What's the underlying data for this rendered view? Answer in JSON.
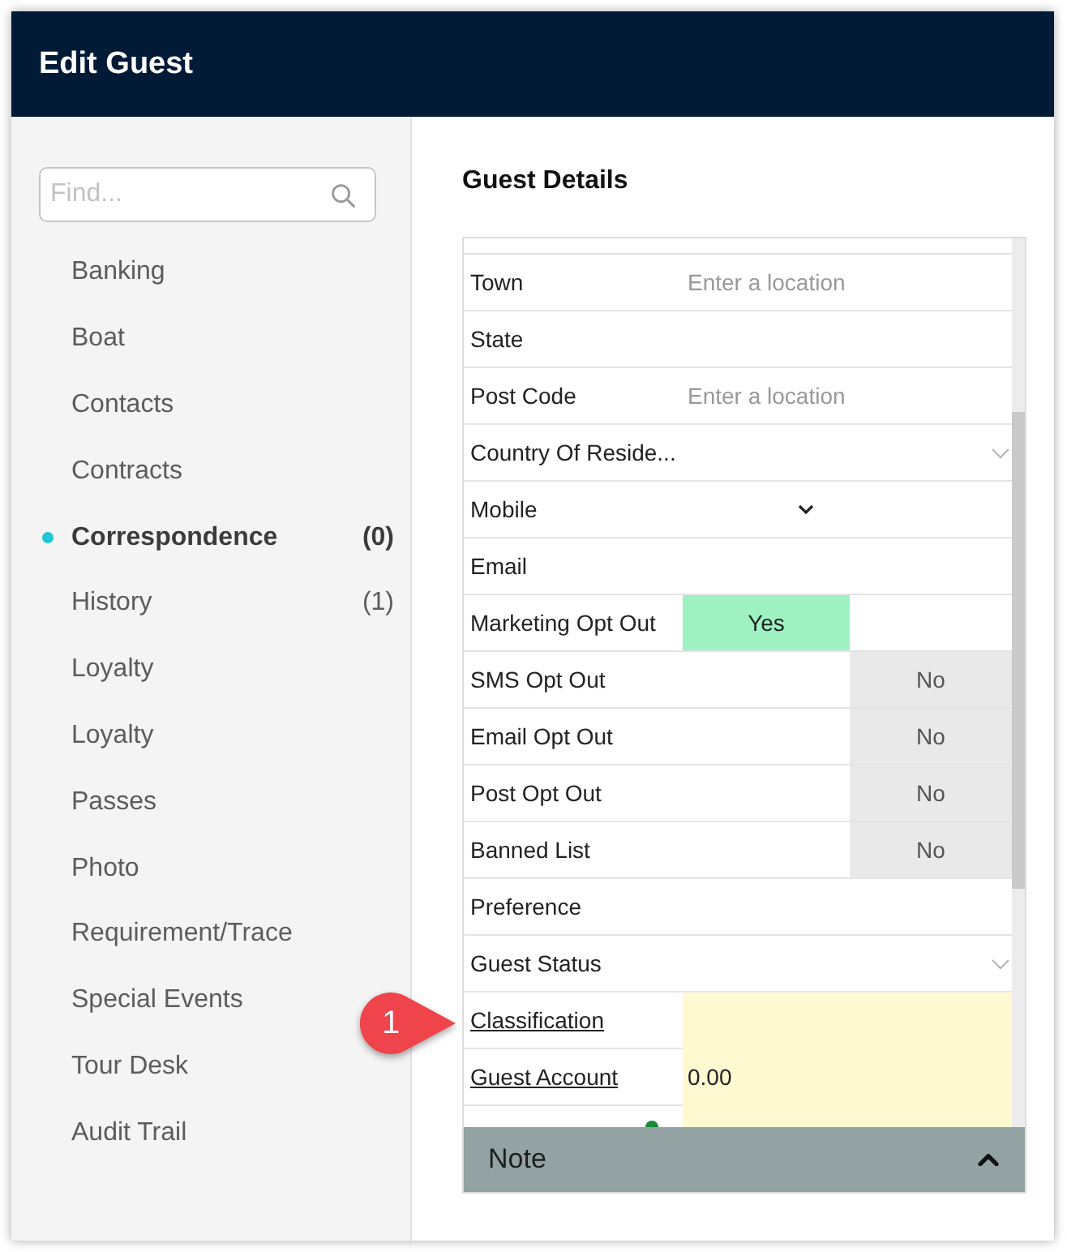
{
  "window": {
    "title": "Edit Guest"
  },
  "sidebar": {
    "search": {
      "placeholder": "Find..."
    },
    "items": [
      {
        "label": "Banking",
        "selected": false
      },
      {
        "label": "Boat",
        "selected": false
      },
      {
        "label": "Contacts",
        "selected": false
      },
      {
        "label": "Contracts",
        "selected": false
      },
      {
        "label": "Correspondence",
        "selected": true,
        "count": "(0)"
      },
      {
        "label": "History",
        "selected": false,
        "count": "(1)"
      },
      {
        "label": "Loyalty",
        "selected": false
      },
      {
        "label": "Loyalty",
        "selected": false
      },
      {
        "label": "Passes",
        "selected": false
      },
      {
        "label": "Photo",
        "selected": false
      },
      {
        "label": "Requirement/Trace",
        "selected": false
      },
      {
        "label": "Special Events",
        "selected": false
      },
      {
        "label": "Tour Desk",
        "selected": false
      },
      {
        "label": "Audit Trail",
        "selected": false
      }
    ]
  },
  "guest_details": {
    "title": "Guest Details",
    "rows": [
      {
        "label": "Town",
        "kind": "location",
        "placeholder": "Enter a location"
      },
      {
        "label": "State",
        "kind": "text"
      },
      {
        "label": "Post Code",
        "kind": "location",
        "placeholder": "Enter a location"
      },
      {
        "label": "Country Of Reside...",
        "kind": "dropdown"
      },
      {
        "label": "Mobile",
        "kind": "phone"
      },
      {
        "label": "Email",
        "kind": "text"
      },
      {
        "label": "Marketing Opt Out",
        "kind": "toggle",
        "value": "Yes",
        "on": true
      },
      {
        "label": "SMS Opt Out",
        "kind": "toggle",
        "value": "No",
        "on": false
      },
      {
        "label": "Email Opt Out",
        "kind": "toggle",
        "value": "No",
        "on": false
      },
      {
        "label": "Post Opt Out",
        "kind": "toggle",
        "value": "No",
        "on": false
      },
      {
        "label": "Banned List",
        "kind": "toggle",
        "value": "No",
        "on": false
      },
      {
        "label": "Preference",
        "kind": "text"
      },
      {
        "label": "Guest Status",
        "kind": "dropdown"
      },
      {
        "label": "Classification",
        "kind": "link"
      },
      {
        "label": "Guest Account",
        "kind": "link",
        "value": "0.00"
      }
    ]
  },
  "note_panel": {
    "title": "Note"
  },
  "callout": {
    "number": "1"
  }
}
